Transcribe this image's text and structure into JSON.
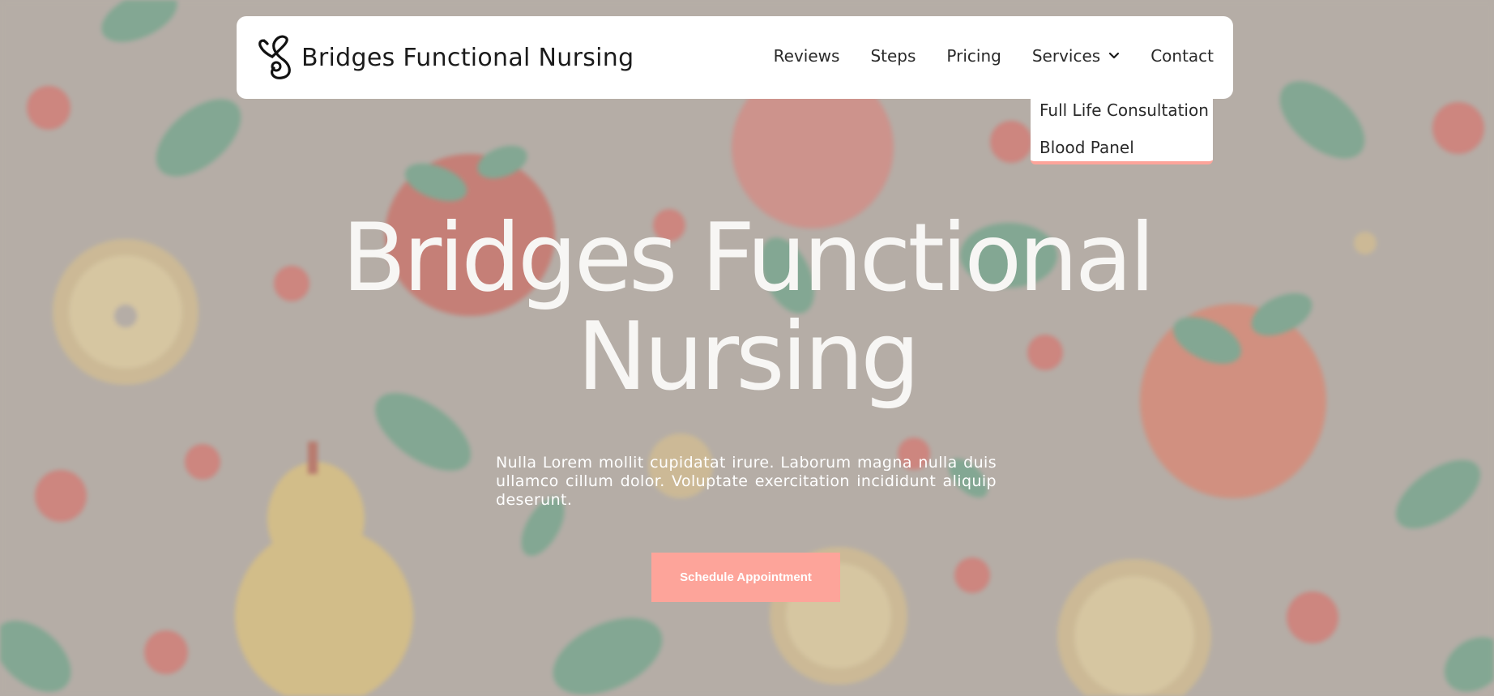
{
  "brand": {
    "name": "Bridges Functional Nursing",
    "logo_icon": "stethoscope-heart-icon"
  },
  "nav": {
    "items": [
      {
        "label": "Reviews"
      },
      {
        "label": "Steps"
      },
      {
        "label": "Pricing"
      },
      {
        "label": "Services",
        "has_dropdown": true,
        "dropdown_open": true
      },
      {
        "label": "Contact"
      }
    ],
    "dropdown_icon": "chevron-down-icon"
  },
  "services_dropdown": {
    "items": [
      "Full Life Consultation",
      "Blood Panel"
    ]
  },
  "hero": {
    "title_line1": "Bridges Functional",
    "title_line2": "Nursing",
    "text": "Nulla Lorem mollit cupidatat irure. Laborum magna nulla duis ullamco cillum dolor. Voluptate exercitation incididunt aliquip deserunt.",
    "cta_label": "Schedule Appointment",
    "background": "fruit-pattern-blurred"
  },
  "colors": {
    "accent": "#fda49a",
    "nav_bg": "#ffffff",
    "hero_bg": "#bcb5ae",
    "title_text": "#f7f6f4"
  }
}
